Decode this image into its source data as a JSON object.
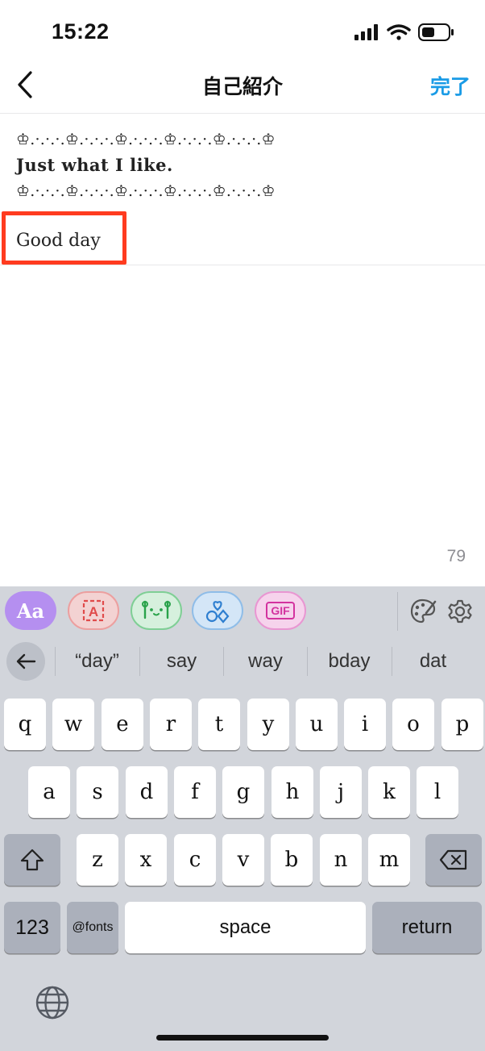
{
  "status_bar": {
    "time": "15:22"
  },
  "nav": {
    "title": "自己紹介",
    "done_label": "完了"
  },
  "bio": {
    "lines": [
      "♔.·.·.·.♔.·.·.·.♔.·.·.·.♔.·.·.·.♔.·.·.·.♔",
      "Just what I like.",
      "♔.·.·.·.♔.·.·.·.♔.·.·.·.♔.·.·.·.♔.·.·.·.♔",
      "Good day"
    ],
    "char_count": "79"
  },
  "keyboard": {
    "toolbar": {
      "fonts_label": "Aa",
      "gif_label": "GIF",
      "icons": [
        "font-style-icon",
        "text-frame-icon",
        "kaomoji-icon",
        "symbols-icon",
        "gif-icon",
        "palette-icon",
        "settings-gear-icon"
      ]
    },
    "suggestions": [
      "“day”",
      "say",
      "way",
      "bday",
      "dat"
    ],
    "rows": [
      [
        "q",
        "w",
        "e",
        "r",
        "t",
        "y",
        "u",
        "i",
        "o",
        "p"
      ],
      [
        "a",
        "s",
        "d",
        "f",
        "g",
        "h",
        "j",
        "k",
        "l"
      ],
      [
        "z",
        "x",
        "c",
        "v",
        "b",
        "n",
        "m"
      ]
    ],
    "numbers_label": "123",
    "fonts_key_label": "@fonts",
    "space_label": "space",
    "return_label": "return"
  },
  "colors": {
    "accent": "#1a9be6",
    "highlight": "#ff3b1f",
    "keyboard_bg": "#d2d5db"
  }
}
